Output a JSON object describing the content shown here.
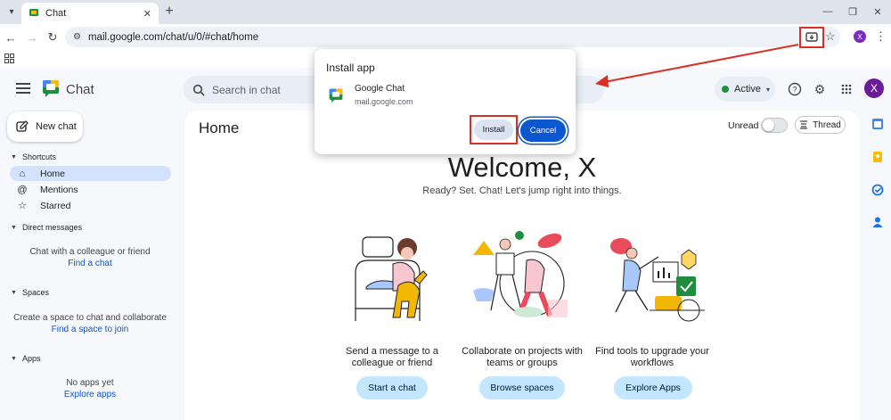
{
  "browser": {
    "tab_title": "Chat",
    "url": "mail.google.com/chat/u/0/#chat/home",
    "profile_initial": "X"
  },
  "header": {
    "app_name": "Chat",
    "search_placeholder": "Search in chat",
    "status_label": "Active",
    "avatar_initial": "X"
  },
  "sidebar": {
    "new_chat_label": "New chat",
    "shortcuts_heading": "Shortcuts",
    "items": [
      {
        "label": "Home",
        "icon": "home-icon"
      },
      {
        "label": "Mentions",
        "icon": "at-icon"
      },
      {
        "label": "Starred",
        "icon": "star-icon"
      }
    ],
    "direct_messages_heading": "Direct messages",
    "dm_note": "Chat with a colleague or friend",
    "dm_link": "Find a chat",
    "spaces_heading": "Spaces",
    "spaces_note": "Create a space to chat and collaborate",
    "spaces_link": "Find a space to join",
    "apps_heading": "Apps",
    "apps_note": "No apps yet",
    "apps_link": "Explore apps"
  },
  "main": {
    "title": "Home",
    "unread_label": "Unread",
    "thread_label": "Thread",
    "welcome": "Welcome, X",
    "subtitle": "Ready? Set. Chat! Let's jump right into things.",
    "cards": [
      {
        "text": "Send a message to a colleague or friend",
        "button": "Start a chat"
      },
      {
        "text": "Collaborate on projects with teams or groups",
        "button": "Browse spaces"
      },
      {
        "text": "Find tools to upgrade your workflows",
        "button": "Explore Apps"
      }
    ]
  },
  "dialog": {
    "title": "Install app",
    "app_name": "Google Chat",
    "origin": "mail.google.com",
    "install_label": "Install",
    "cancel_label": "Cancel"
  },
  "colors": {
    "accent": "#0b57d0",
    "highlight_red": "#d93025",
    "active_nav": "#d3e3fd",
    "pill_button": "#c2e7ff"
  }
}
